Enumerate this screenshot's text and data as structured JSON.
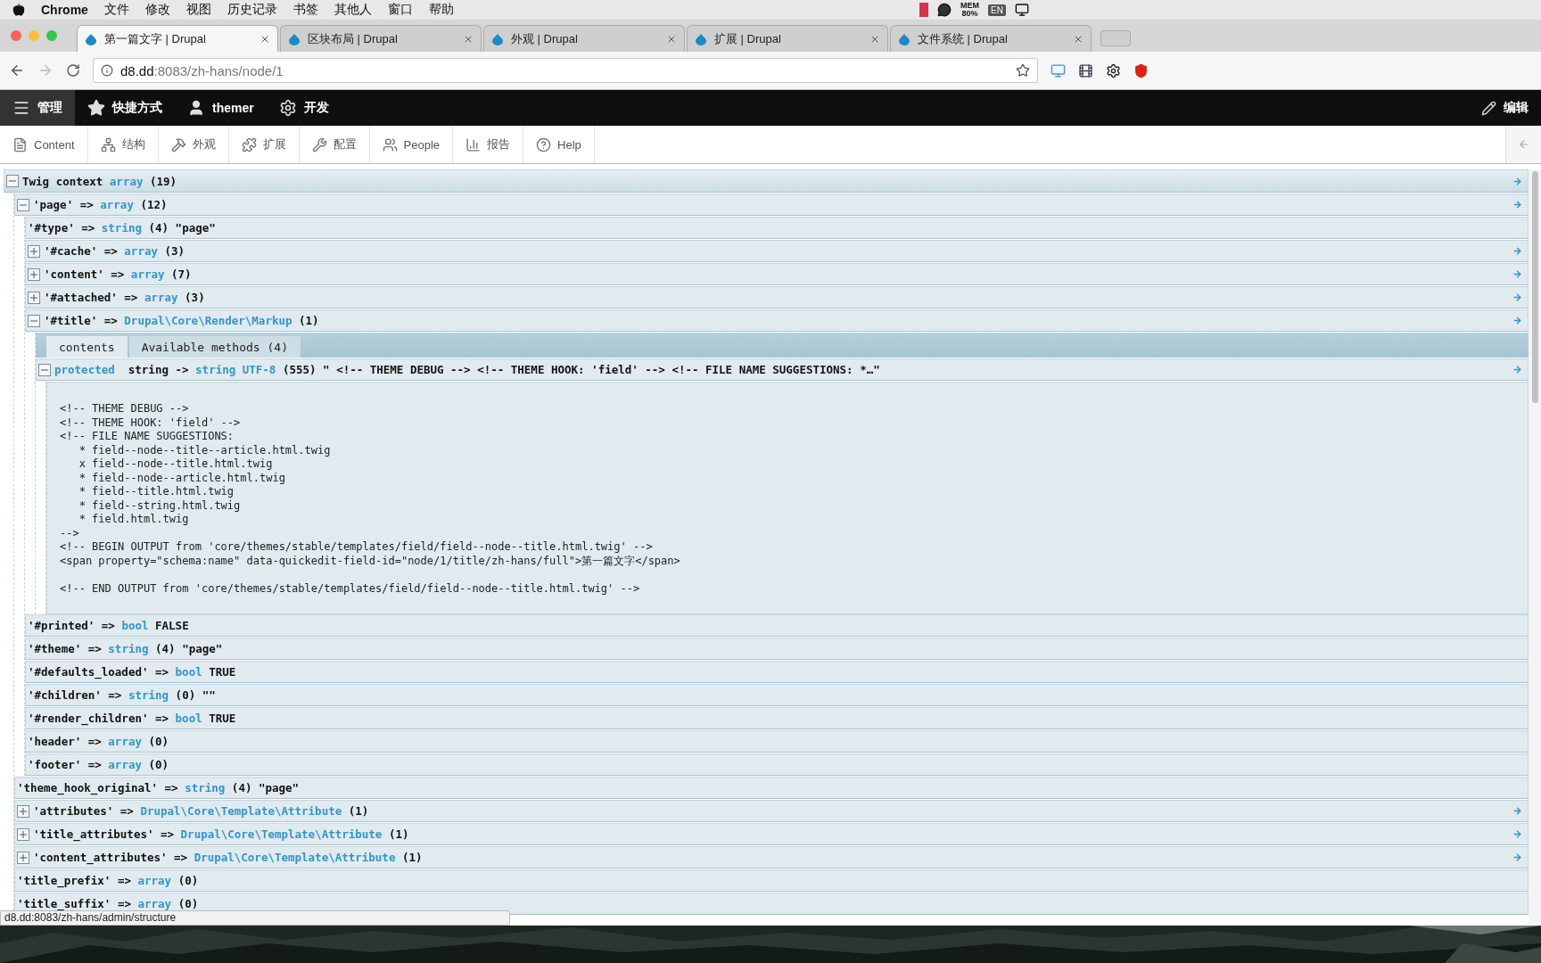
{
  "menubar": {
    "app": "Chrome",
    "items": [
      "文件",
      "修改",
      "视图",
      "历史记录",
      "书签",
      "其他人",
      "窗口",
      "帮助"
    ],
    "mem": {
      "label": "MEM",
      "value": "80%"
    },
    "input_source": "EN"
  },
  "tabs": [
    {
      "title": "第一篇文字 | Drupal",
      "selected": true
    },
    {
      "title": "区块布局 | Drupal",
      "selected": false
    },
    {
      "title": "外观 | Drupal",
      "selected": false
    },
    {
      "title": "扩展 | Drupal",
      "selected": false
    },
    {
      "title": "文件系统 | Drupal",
      "selected": false
    }
  ],
  "address": {
    "host": "d8.dd",
    "path": ":8083/zh-hans/node/1"
  },
  "admin_toolbar": {
    "items": [
      {
        "label": "管理",
        "selected": true
      },
      {
        "label": "快捷方式",
        "selected": false
      },
      {
        "label": "themer",
        "selected": false
      },
      {
        "label": "开发",
        "selected": false
      }
    ],
    "edit": "编辑"
  },
  "tray": [
    {
      "label": "Content"
    },
    {
      "label": "结构"
    },
    {
      "label": "外观"
    },
    {
      "label": "扩展"
    },
    {
      "label": "配置"
    },
    {
      "label": "People"
    },
    {
      "label": "报告"
    },
    {
      "label": "Help"
    }
  ],
  "tree": [
    {
      "name": "Twig context",
      "type": "array",
      "detail": "(19)",
      "expandable": true,
      "expanded": true,
      "children": [
        {
          "name": "'page'",
          "op": "=>",
          "type": "array",
          "detail": "(12)",
          "expandable": true,
          "expanded": true,
          "children": [
            {
              "name": "'#type'",
              "op": "=>",
              "type": "string",
              "detail": "(4) \"page\"",
              "expandable": false
            },
            {
              "name": "'#cache'",
              "op": "=>",
              "type": "array",
              "detail": "(3)",
              "expandable": true,
              "expanded": false
            },
            {
              "name": "'content'",
              "op": "=>",
              "type": "array",
              "detail": "(7)",
              "expandable": true,
              "expanded": false
            },
            {
              "name": "'#attached'",
              "op": "=>",
              "type": "array",
              "detail": "(3)",
              "expandable": true,
              "expanded": false
            },
            {
              "name": "'#title'",
              "op": "=>",
              "type": "Drupal\\Core\\Render\\Markup",
              "detail": "(1)",
              "expandable": true,
              "expanded": true,
              "tabs": [
                {
                  "label": "contents",
                  "selected": true
                },
                {
                  "label": "Available methods (4)",
                  "selected": false
                }
              ],
              "children": [
                {
                  "access": "protected",
                  "name": "string",
                  "op": "->",
                  "type": "string UTF-8",
                  "detail": "(555) \" <!-- THEME DEBUG --> <!-- THEME HOOK: 'field' --> <!-- FILE NAME SUGGESTIONS: *…\"",
                  "expandable": true,
                  "expanded": true,
                  "pre": [
                    [
                      "<!-- THEME DEBUG -->",
                      "<!-- THEME HOOK: 'field' -->",
                      "<!-- FILE NAME SUGGESTIONS:",
                      "   * field--node--title--article.html.twig",
                      "   x field--node--title.html.twig",
                      "   * field--node--article.html.twig",
                      "   * field--title.html.twig",
                      "   * field--string.html.twig",
                      "   * field.html.twig",
                      "-->",
                      "<!-- BEGIN OUTPUT from 'core/themes/stable/templates/field/field--node--title.html.twig' -->",
                      "<span property=\"schema:name\" data-quickedit-field-id=\"node/1/title/zh-hans/full\">第一篇文字</span>"
                    ],
                    [
                      "<!-- END OUTPUT from 'core/themes/stable/templates/field/field--node--title.html.twig' -->"
                    ]
                  ]
                }
              ]
            },
            {
              "name": "'#printed'",
              "op": "=>",
              "type": "bool",
              "detail": "FALSE",
              "expandable": false
            },
            {
              "name": "'#theme'",
              "op": "=>",
              "type": "string",
              "detail": "(4) \"page\"",
              "expandable": false
            },
            {
              "name": "'#defaults_loaded'",
              "op": "=>",
              "type": "bool",
              "detail": "TRUE",
              "expandable": false
            },
            {
              "name": "'#children'",
              "op": "=>",
              "type": "string",
              "detail": "(0) \"\"",
              "expandable": false
            },
            {
              "name": "'#render_children'",
              "op": "=>",
              "type": "bool",
              "detail": "TRUE",
              "expandable": false
            },
            {
              "name": "'header'",
              "op": "=>",
              "type": "array",
              "detail": "(0)",
              "expandable": false
            },
            {
              "name": "'footer'",
              "op": "=>",
              "type": "array",
              "detail": "(0)",
              "expandable": false
            }
          ]
        },
        {
          "name": "'theme_hook_original'",
          "op": "=>",
          "type": "string",
          "detail": "(4) \"page\"",
          "expandable": false
        },
        {
          "name": "'attributes'",
          "op": "=>",
          "type": "Drupal\\Core\\Template\\Attribute",
          "detail": "(1)",
          "expandable": true,
          "expanded": false
        },
        {
          "name": "'title_attributes'",
          "op": "=>",
          "type": "Drupal\\Core\\Template\\Attribute",
          "detail": "(1)",
          "expandable": true,
          "expanded": false
        },
        {
          "name": "'content_attributes'",
          "op": "=>",
          "type": "Drupal\\Core\\Template\\Attribute",
          "detail": "(1)",
          "expandable": true,
          "expanded": false
        },
        {
          "name": "'title_prefix'",
          "op": "=>",
          "type": "array",
          "detail": "(0)",
          "expandable": false
        },
        {
          "name": "'title_suffix'",
          "op": "=>",
          "type": "array",
          "detail": "(0)",
          "expandable": false
        }
      ]
    }
  ],
  "status_url": "d8.dd:8083/zh-hans/admin/structure"
}
